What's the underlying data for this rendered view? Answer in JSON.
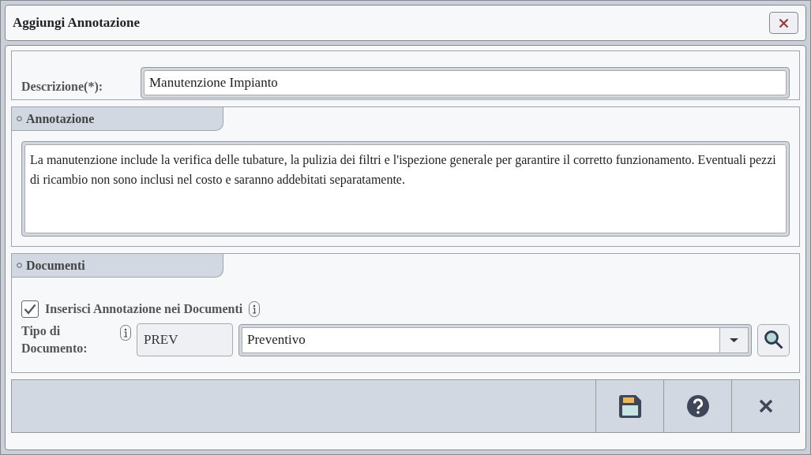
{
  "window": {
    "title": "Aggiungi Annotazione"
  },
  "description": {
    "label": "Descrizione(*):",
    "value": "Manutenzione Impianto"
  },
  "annotation": {
    "title": "Annotazione",
    "text": "La manutenzione include la verifica delle tubature, la pulizia dei filtri e l'ispezione generale per garantire il corretto funzionamento. Eventuali pezzi di ricambio non sono inclusi nel costo e saranno addebitati separatamente."
  },
  "documents": {
    "title": "Documenti",
    "insert": {
      "label": "Inserisci Annotazione nei Documenti",
      "checked": true
    },
    "type_label": "Tipo di Documento:",
    "type_code": "PREV",
    "type_value": "Preventivo"
  }
}
